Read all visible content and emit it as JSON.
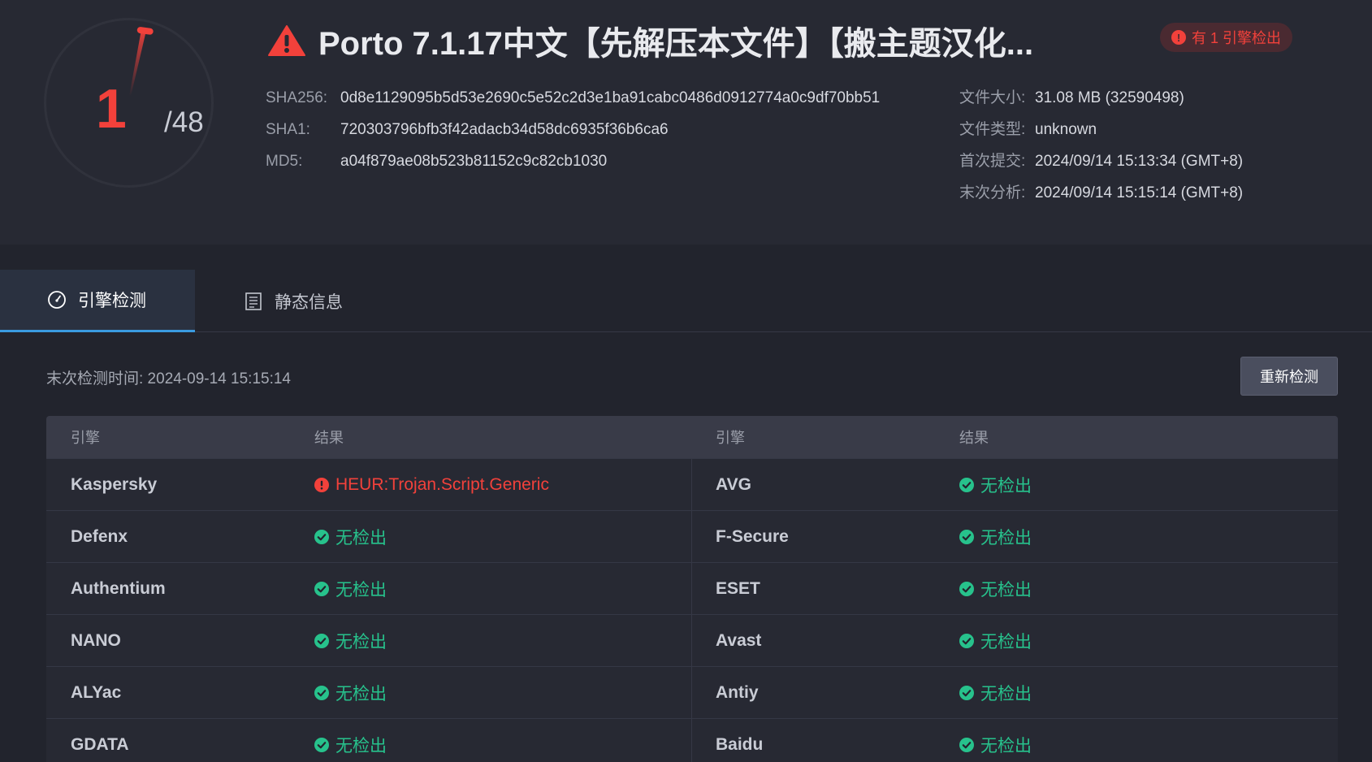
{
  "gauge": {
    "detected": "1",
    "total": "/48",
    "detected_fraction": 0.0208,
    "color": "#f2413b"
  },
  "header": {
    "title": "Porto 7.1.17中文【先解压本文件】【搬主题汉化...",
    "badge": "有 1 引擎检出",
    "badge_icon": "exclamation-icon"
  },
  "hashes": [
    {
      "label": "SHA256:",
      "value": "0d8e1129095b5d53e2690c5e52c2d3e1ba91cabc0486d0912774a0c9df70bb51"
    },
    {
      "label": "SHA1:",
      "value": "720303796bfb3f42adacb34d58dc6935f36b6ca6"
    },
    {
      "label": "MD5:",
      "value": "a04f879ae08b523b81152c9c82cb1030"
    }
  ],
  "file_info": [
    {
      "label": "文件大小:",
      "value": "31.08 MB (32590498)"
    },
    {
      "label": "文件类型:",
      "value": "unknown"
    },
    {
      "label": "首次提交:",
      "value": "2024/09/14 15:13:34 (GMT+8)"
    },
    {
      "label": "末次分析:",
      "value": "2024/09/14 15:15:14 (GMT+8)"
    }
  ],
  "tabs": [
    {
      "label": "引擎检测",
      "icon": "gauge-icon",
      "active": true
    },
    {
      "label": "静态信息",
      "icon": "document-list-icon",
      "active": false
    }
  ],
  "last_check": "末次检测时间: 2024-09-14 15:15:14",
  "rescan_label": "重新检测",
  "table": {
    "headers": [
      "引擎",
      "结果",
      "引擎",
      "结果"
    ],
    "rows": [
      {
        "left": {
          "engine": "Kaspersky",
          "result": "HEUR:Trojan.Script.Generic",
          "status": "bad"
        },
        "right": {
          "engine": "AVG",
          "result": "无检出",
          "status": "ok"
        }
      },
      {
        "left": {
          "engine": "Defenx",
          "result": "无检出",
          "status": "ok"
        },
        "right": {
          "engine": "F-Secure",
          "result": "无检出",
          "status": "ok"
        }
      },
      {
        "left": {
          "engine": "Authentium",
          "result": "无检出",
          "status": "ok"
        },
        "right": {
          "engine": "ESET",
          "result": "无检出",
          "status": "ok"
        }
      },
      {
        "left": {
          "engine": "NANO",
          "result": "无检出",
          "status": "ok"
        },
        "right": {
          "engine": "Avast",
          "result": "无检出",
          "status": "ok"
        }
      },
      {
        "left": {
          "engine": "ALYac",
          "result": "无检出",
          "status": "ok"
        },
        "right": {
          "engine": "Antiy",
          "result": "无检出",
          "status": "ok"
        }
      },
      {
        "left": {
          "engine": "GDATA",
          "result": "无检出",
          "status": "ok"
        },
        "right": {
          "engine": "Baidu",
          "result": "无检出",
          "status": "ok"
        }
      }
    ]
  },
  "colors": {
    "ok": "#27c28c",
    "bad": "#f2413b",
    "accent": "#3a9be0"
  }
}
